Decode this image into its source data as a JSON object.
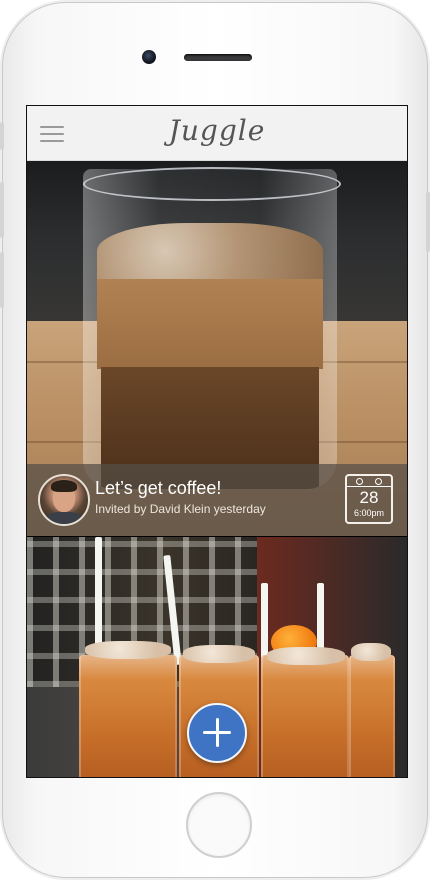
{
  "app": {
    "title": "Juggle"
  },
  "icons": {
    "menu": "hamburger-menu-icon",
    "calendar": "calendar-icon",
    "add": "plus-icon"
  },
  "feed": [
    {
      "image": "iced-coffee-photo",
      "title": "Let’s get coffee!",
      "subtitle": "Invited by David Klein yesterday",
      "calendar": {
        "day": "28",
        "time": "6:00pm"
      }
    },
    {
      "image": "iced-tea-glasses-photo"
    }
  ],
  "colors": {
    "accent": "#3f73c3",
    "navbar": "#f2f2f2",
    "overlay": "#554e46"
  }
}
